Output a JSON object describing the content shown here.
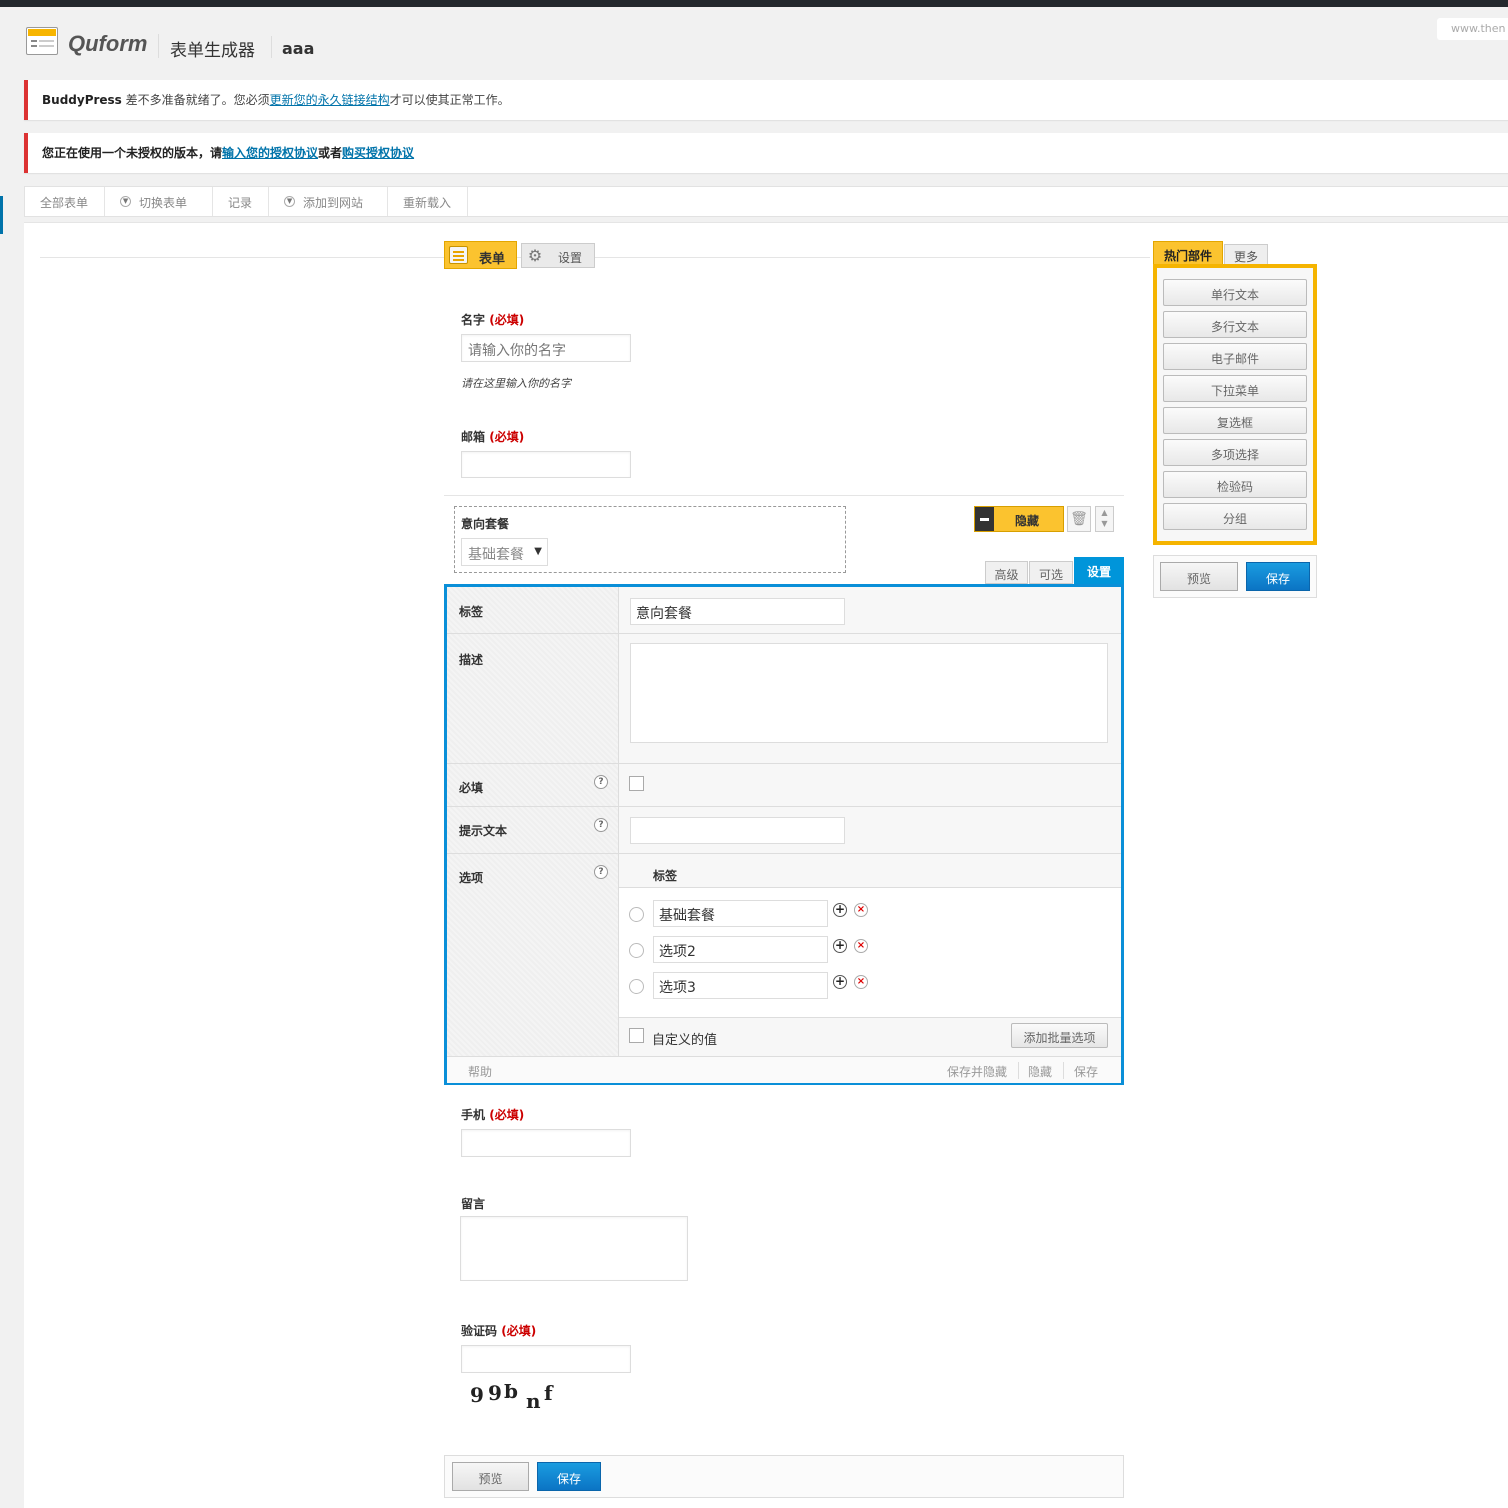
{
  "header": {
    "brand": "Quform",
    "subtitle": "表单生成器",
    "form_name": "aaa",
    "url_snippet": "www.then"
  },
  "notices": [
    {
      "prefix_bold": "BuddyPress",
      "text1": " 差不多准备就绪了。您必须",
      "link": "更新您的永久链接结构",
      "text2": "才可以使其正常工作。"
    },
    {
      "text1": "您正在使用一个未授权的版本，请",
      "link1": "输入您的授权协议",
      "text2": "或者",
      "link2": "购买授权协议"
    }
  ],
  "toolbar": {
    "all_forms": "全部表单",
    "switch_form": "切换表单",
    "records": "记录",
    "add_to_site": "添加到网站",
    "reload": "重新载入"
  },
  "tabs": {
    "form": "表单",
    "settings": "设置"
  },
  "fields": {
    "name": {
      "label": "名字",
      "required": "(必填)",
      "placeholder": "请输入你的名字",
      "hint": "请在这里输入你的名字"
    },
    "email": {
      "label": "邮箱",
      "required": "(必填)"
    },
    "package": {
      "label": "意向套餐",
      "selected": "基础套餐"
    },
    "phone": {
      "label": "手机",
      "required": "(必填)"
    },
    "message": {
      "label": "留言"
    },
    "captcha": {
      "label": "验证码",
      "required": "(必填)",
      "image_text": "99b nf"
    }
  },
  "field_controls": {
    "hide": "隐藏"
  },
  "subtabs": {
    "advanced": "高级",
    "optional": "可选",
    "settings": "设置"
  },
  "settings_panel": {
    "label_row": {
      "label": "标签",
      "value": "意向套餐"
    },
    "desc_row": {
      "label": "描述"
    },
    "required_row": {
      "label": "必填"
    },
    "tooltip_row": {
      "label": "提示文本"
    },
    "options_row": {
      "label": "选项",
      "column_header": "标签",
      "items": [
        "基础套餐",
        "选项2",
        "选项3"
      ],
      "custom_value": "自定义的值",
      "bulk_add": "添加批量选项"
    },
    "footer": {
      "help": "帮助",
      "save_hide": "保存并隐藏",
      "hide": "隐藏",
      "save": "保存"
    }
  },
  "widgets": {
    "tab_popular": "热门部件",
    "tab_more": "更多",
    "items": [
      "单行文本",
      "多行文本",
      "电子邮件",
      "下拉菜单",
      "复选框",
      "多项选择",
      "检验码",
      "分组"
    ]
  },
  "actions": {
    "preview": "预览",
    "save": "保存"
  },
  "colors": {
    "accent_yellow": "#fbc32f",
    "accent_blue": "#0a8fd8",
    "required_red": "#cc0000",
    "notice_red": "#dc3232"
  }
}
